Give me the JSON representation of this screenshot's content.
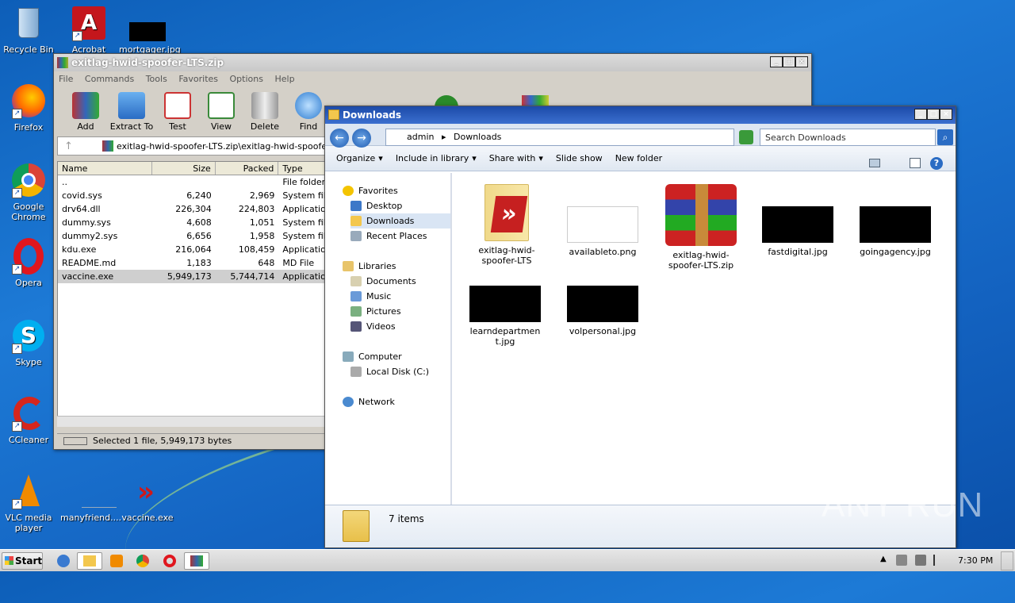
{
  "desktop": {
    "icons": [
      {
        "label": "Recycle Bin"
      },
      {
        "label": "Acrobat"
      },
      {
        "label": "mortgager.jpg"
      },
      {
        "label": "Firefox"
      },
      {
        "label": "Google Chrome"
      },
      {
        "label": "Opera"
      },
      {
        "label": "Skype"
      },
      {
        "label": "CCleaner"
      },
      {
        "label": "VLC media player"
      },
      {
        "label": "manyfriend...."
      },
      {
        "label": "vaccine.exe"
      }
    ]
  },
  "winrar": {
    "title": "exitlag-hwid-spoofer-LTS.zip",
    "menu": [
      "File",
      "Commands",
      "Tools",
      "Favorites",
      "Options",
      "Help"
    ],
    "toolbar": [
      "Add",
      "Extract To",
      "Test",
      "View",
      "Delete",
      "Find"
    ],
    "path": "exitlag-hwid-spoofer-LTS.zip\\exitlag-hwid-spoofer-LTS",
    "columns": [
      "Name",
      "Size",
      "Packed",
      "Type"
    ],
    "rows": [
      {
        "name": "..",
        "size": "",
        "packed": "",
        "type": "File folder"
      },
      {
        "name": "covid.sys",
        "size": "6,240",
        "packed": "2,969",
        "type": "System file"
      },
      {
        "name": "drv64.dll",
        "size": "226,304",
        "packed": "224,803",
        "type": "Application"
      },
      {
        "name": "dummy.sys",
        "size": "4,608",
        "packed": "1,051",
        "type": "System file"
      },
      {
        "name": "dummy2.sys",
        "size": "6,656",
        "packed": "1,958",
        "type": "System file"
      },
      {
        "name": "kdu.exe",
        "size": "216,064",
        "packed": "108,459",
        "type": "Application"
      },
      {
        "name": "README.md",
        "size": "1,183",
        "packed": "648",
        "type": "MD File"
      },
      {
        "name": "vaccine.exe",
        "size": "5,949,173",
        "packed": "5,744,714",
        "type": "Application"
      }
    ],
    "status": "Selected 1 file, 5,949,173 bytes"
  },
  "explorer": {
    "title": "Downloads",
    "breadcrumb": [
      "admin",
      "Downloads"
    ],
    "search_placeholder": "Search Downloads",
    "commands": [
      "Organize",
      "Include in library",
      "Share with",
      "Slide show",
      "New folder"
    ],
    "nav": {
      "favorites": "Favorites",
      "desktop": "Desktop",
      "downloads": "Downloads",
      "recent": "Recent Places",
      "libraries": "Libraries",
      "documents": "Documents",
      "music": "Music",
      "pictures": "Pictures",
      "videos": "Videos",
      "computer": "Computer",
      "local_disk": "Local Disk (C:)",
      "network": "Network"
    },
    "files": [
      {
        "name": "exitlag-hwid-spoofer-LTS"
      },
      {
        "name": "availableto.png"
      },
      {
        "name": "exitlag-hwid-spoofer-LTS.zip"
      },
      {
        "name": "fastdigital.jpg"
      },
      {
        "name": "goingagency.jpg"
      },
      {
        "name": "learndepartment.jpg"
      },
      {
        "name": "volpersonal.jpg"
      }
    ],
    "item_count": "7 items"
  },
  "taskbar": {
    "start": "Start",
    "clock": "7:30 PM"
  },
  "watermark": "ANY RUN"
}
